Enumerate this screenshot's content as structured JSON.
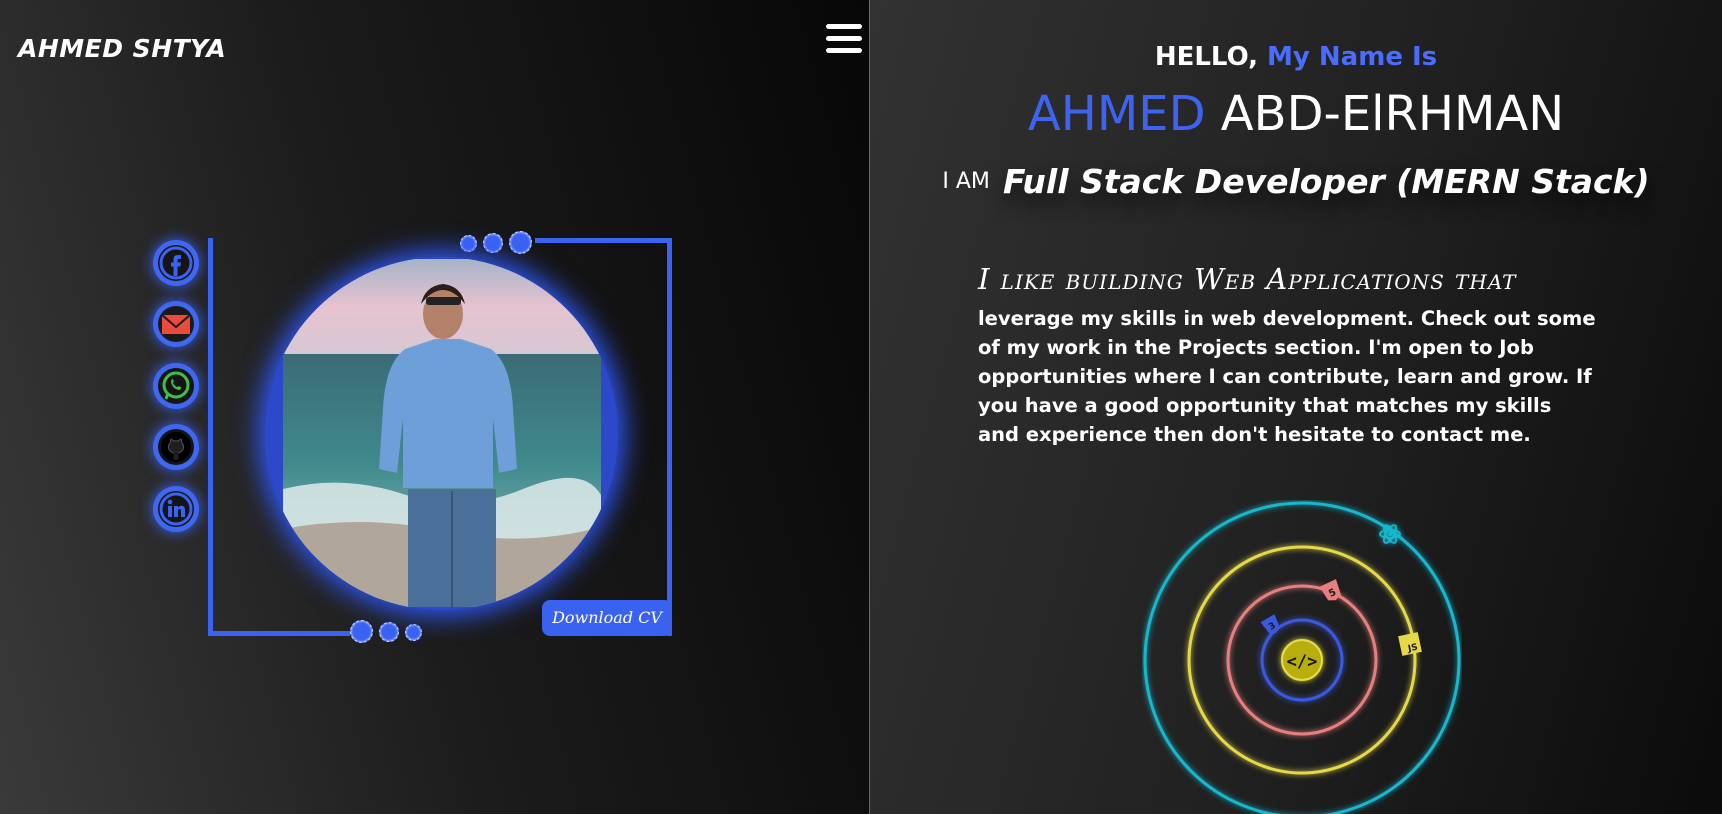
{
  "header": {
    "logo": "AHMED SHTYA",
    "menu_icon": "hamburger-icon"
  },
  "social": [
    {
      "name": "facebook",
      "icon": "facebook-icon"
    },
    {
      "name": "email",
      "icon": "mail-icon"
    },
    {
      "name": "whatsapp",
      "icon": "whatsapp-icon"
    },
    {
      "name": "github",
      "icon": "github-icon"
    },
    {
      "name": "linkedin",
      "icon": "linkedin-icon"
    }
  ],
  "profile": {
    "download_cv": "Download CV"
  },
  "hero": {
    "hello": "HELLO,",
    "my_name_is": "My Name Is",
    "first_name": "AHMED",
    "last_name": "ABD-ElRHMAN",
    "i_am": "I AM",
    "role": "Full Stack Developer (MERN Stack)"
  },
  "intro": {
    "heading": "I like building Web Applications that",
    "body": "leverage my skills in web development. Check out some of my work in the Projects section. I'm open to Job opportunities where I can contribute, learn and grow. If you have a good opportunity that matches my skills and experience then don't hesitate to contact me."
  },
  "orbit": {
    "icons": [
      "react-icon",
      "html5-icon",
      "css3-icon",
      "javascript-icon",
      "code-icon"
    ],
    "core_label": "</>",
    "js_label": "JS",
    "colors": {
      "outer": "#19b8cf",
      "middle": "#e5d94a",
      "inner": "#e87f7f",
      "core_ring": "#3a59e0"
    }
  },
  "colors": {
    "accent": "#3b63f2",
    "background": "#0b0b0b",
    "text": "#ffffff"
  }
}
